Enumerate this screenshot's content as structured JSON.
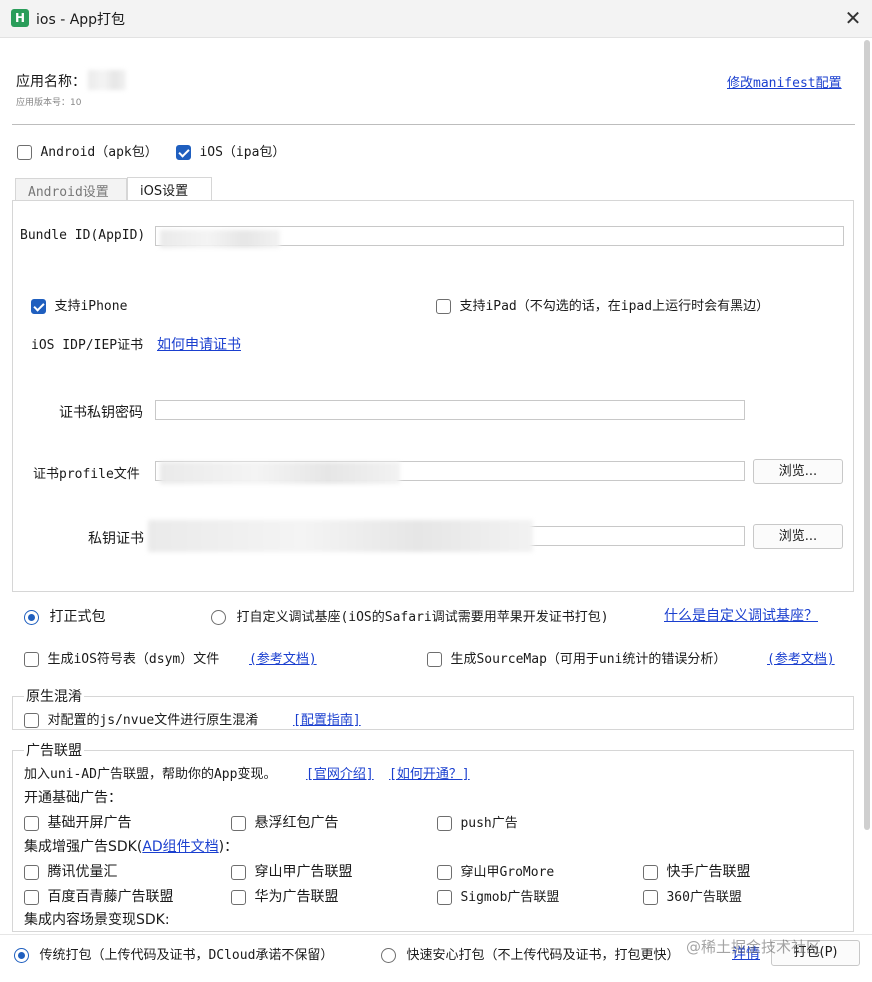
{
  "window": {
    "title": "ios - App打包",
    "logo": "H",
    "close_icon": "✕"
  },
  "header": {
    "app_name_label": "应用名称：",
    "version_label": "应用版本号：10",
    "manifest_link": "修改manifest配置"
  },
  "platforms": {
    "android": {
      "label": "Android（apk包）",
      "checked": false
    },
    "ios": {
      "label": "iOS（ipa包）",
      "checked": true
    }
  },
  "tabs": [
    {
      "label": "Android设置",
      "active": false
    },
    {
      "label": "iOS设置",
      "active": true
    }
  ],
  "ios_settings": {
    "bundle_id_label": "Bundle ID(AppID)",
    "support_iphone": {
      "label": "支持iPhone",
      "checked": true
    },
    "support_ipad": {
      "label": "支持iPad（不勾选的话，在ipad上运行时会有黑边）",
      "checked": false
    },
    "cert_type_label": "iOS IDP/IEP证书",
    "how_to_apply_link": "如何申请证书",
    "cert_password_label": "证书私钥密码",
    "profile_label": "证书profile文件",
    "private_key_label": "私钥证书",
    "browse_label": "浏览..."
  },
  "build_mode": {
    "formal": {
      "label": "打正式包",
      "checked": true
    },
    "custom_base": {
      "label": "打自定义调试基座(iOS的Safari调试需要用苹果开发证书打包)",
      "checked": false
    },
    "custom_base_link": "什么是自定义调试基座？"
  },
  "extras": {
    "dsym": {
      "label": "生成iOS符号表（dsym）文件",
      "checked": false
    },
    "dsym_link": "(参考文档)",
    "sourcemap": {
      "label": "生成SourceMap（可用于uni统计的错误分析）",
      "checked": false
    },
    "sourcemap_link": "(参考文档)"
  },
  "native_obfuscation": {
    "title": "原生混淆",
    "option": {
      "label": "对配置的js/nvue文件进行原生混淆",
      "checked": false
    },
    "link": "[配置指南]"
  },
  "ads": {
    "title": "广告联盟",
    "intro": "加入uni-AD广告联盟，帮助你的App变现。",
    "intro_link_1": "[官网介绍]",
    "intro_link_2": "[如何开通？]",
    "basic_title": "开通基础广告：",
    "basic": [
      {
        "label": "基础开屏广告",
        "checked": false
      },
      {
        "label": "悬浮红包广告",
        "checked": false
      },
      {
        "label": "push广告",
        "checked": false
      }
    ],
    "enhanced_title_prefix": "集成增强广告SDK(",
    "enhanced_title_link": "AD组件文档",
    "enhanced_title_suffix": ")：",
    "enhanced": [
      {
        "label": "腾讯优量汇",
        "checked": false
      },
      {
        "label": "穿山甲广告联盟",
        "checked": false
      },
      {
        "label": "穿山甲GroMore",
        "checked": false
      },
      {
        "label": "快手广告联盟",
        "checked": false
      },
      {
        "label": "百度百青藤广告联盟",
        "checked": false
      },
      {
        "label": "华为广告联盟",
        "checked": false
      },
      {
        "label": "Sigmob广告联盟",
        "checked": false
      },
      {
        "label": "360广告联盟",
        "checked": false
      }
    ],
    "content_title": "集成内容场景变现SDK:"
  },
  "footer": {
    "traditional": {
      "label": "传统打包（上传代码及证书，DCloud承诺不保留）",
      "checked": true
    },
    "fast": {
      "label": "快速安心打包（不上传代码及证书，打包更快）",
      "checked": false
    },
    "detail_link": "详情",
    "pack_button": "打包(P)",
    "watermark": "@稀土掘金技术社区"
  }
}
